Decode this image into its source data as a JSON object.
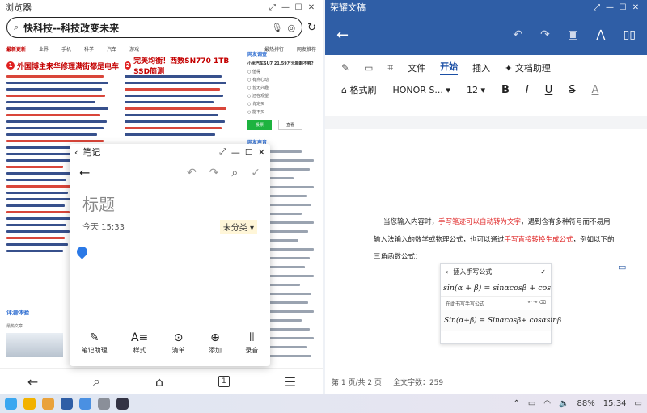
{
  "browser": {
    "app_title": "浏览器",
    "search_query": "快科技--科技改变未来",
    "nav": [
      "最新更新",
      "业界",
      "手机",
      "科学",
      "汽车",
      "游戏"
    ],
    "nav_right": [
      "最热排行",
      "网友推荐"
    ],
    "headline1_num": "1",
    "headline1": "外国博主来华修理满街都是电车",
    "headline2_num": "2",
    "headline2": "完美均衡！西数SN770 1TB SSD简测",
    "sidebar_title": "网友调查",
    "sidebar_question": "小米汽车SU7 21.59万元能翻不够?",
    "sidebar_options": [
      "值得",
      "有点心动",
      "暂无兴趣",
      "还在观望",
      "肯定买",
      "能不买"
    ],
    "vote_label": "投票",
    "result_label": "查看",
    "sidebar_title2": "网友声音",
    "eval_title": "评测体验",
    "eval_sub": "最热文章"
  },
  "notes": {
    "app_title": "笔记",
    "heading": "标题",
    "time": "今天 15:33",
    "category": "未分类",
    "tools": [
      "笔记助理",
      "样式",
      "清单",
      "添加",
      "录音"
    ]
  },
  "doc": {
    "app_title": "荣耀文稿",
    "tabs": [
      "文件",
      "开始",
      "插入",
      "文档助理"
    ],
    "active_tab": "开始",
    "format_painter": "格式刷",
    "font_name": "HONOR S...",
    "font_size": "12",
    "bold": "B",
    "italic": "I",
    "underline": "U",
    "strike": "S",
    "color_a": "A",
    "para1_a": "当您输入内容时，",
    "para1_b": "手写笔迹可以自动转为文字",
    "para1_c": "，遇到含有多种符号而不易用",
    "para2_a": "输入法输入的数学或物理公式，也可以通过",
    "para2_b": "手写直接转换生成公式",
    "para2_c": "，例如以下的",
    "para3": "三角函数公式：",
    "formula_title": "插入手写公式",
    "formula_render": "sin(α + β) = sinαcosβ + cosα",
    "formula_area_label": "在此书写手写公式",
    "formula_hand": "Sin(α+β) = Sinαcosβ+ cosαsinβ",
    "status_page": "第 1 页/共 2 页",
    "status_words": "全文字数：259"
  },
  "taskbar": {
    "battery": "88%",
    "time": "15:34"
  }
}
